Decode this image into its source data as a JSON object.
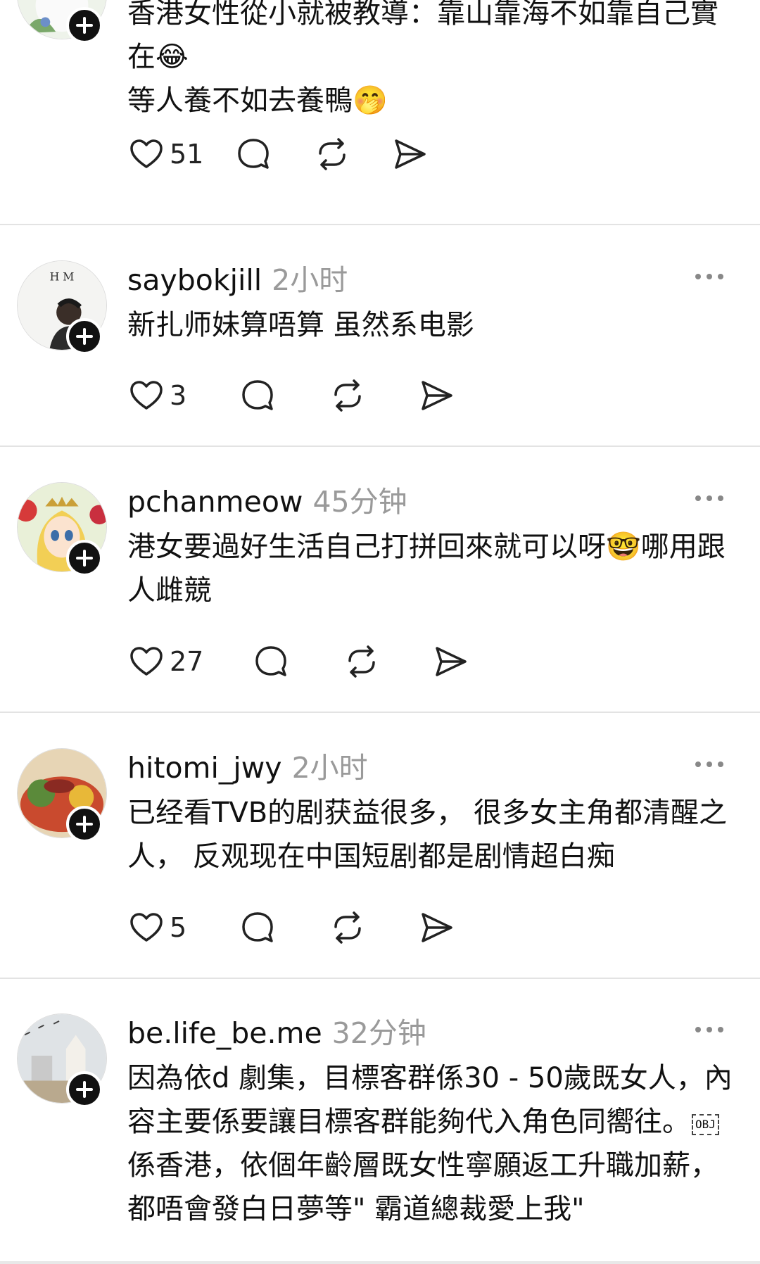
{
  "posts": [
    {
      "username": "",
      "time": "",
      "lines": [
        "香港女性從小就被教導：靠山靠海不如靠自己實在😂",
        "等人養不如去養鴨🤭"
      ],
      "likes": "51"
    },
    {
      "username": "saybokjill",
      "time": "2小时",
      "lines": [
        "新扎师妹算唔算 虽然系电影"
      ],
      "likes": "3",
      "avatar_text": "H M"
    },
    {
      "username": "pchanmeow",
      "time": "45分钟",
      "lines": [
        "港女要過好生活自己打拼回來就可以呀🤓哪用跟人雌競"
      ],
      "likes": "27"
    },
    {
      "username": "hitomi_jwy",
      "time": "2小时",
      "lines": [
        "已经看TVB的剧获益很多， 很多女主角都清醒之人， 反观现在中国短剧都是剧情超白痴"
      ],
      "likes": "5"
    },
    {
      "username": "be.life_be.me",
      "time": "32分钟",
      "text_before_obj": "因為依d 劇集，目標客群係30 - 50歲既女人，內容主要係要讓目標客群能夠代入角色同嚮往。",
      "obj_label": "OBJ",
      "text_after_obj": "係香港，依個年齡層既女性寧願返工升職加薪，都唔會發白日夢等\" 霸道總裁愛上我\""
    }
  ],
  "icons": {
    "like": "heart-icon",
    "reply": "comment-bubble-icon",
    "repost": "repost-icon",
    "share": "send-icon",
    "more": "more-dots-icon",
    "follow": "follow-plus-icon"
  },
  "colors": {
    "text": "#111111",
    "muted": "#9a9a9a",
    "divider": "#e3e3e3"
  }
}
